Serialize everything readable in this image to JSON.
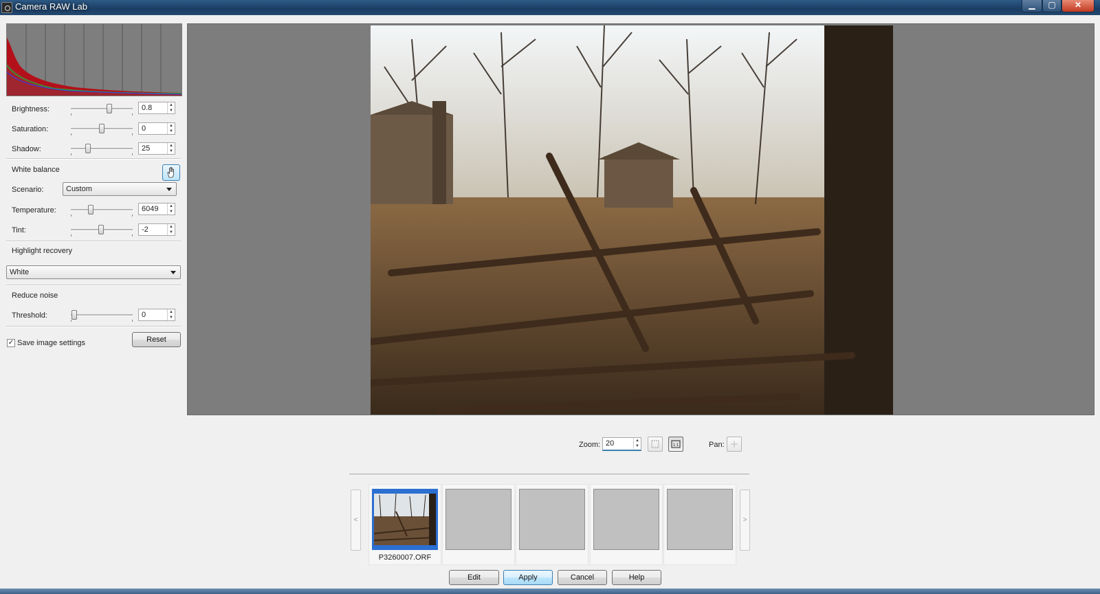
{
  "window": {
    "title": "Camera RAW Lab",
    "minimize": "▁",
    "maximize": "▢",
    "close": "✕"
  },
  "adjust": {
    "brightness": {
      "label": "Brightness:",
      "value": "0.8",
      "level": 0.62
    },
    "saturation": {
      "label": "Saturation:",
      "value": "0",
      "level": 0.5
    },
    "shadow": {
      "label": "Shadow:",
      "value": "25",
      "level": 0.28
    },
    "white_balance": {
      "label": "White balance",
      "button_icon": "hand-picker-icon"
    },
    "scenario": {
      "label": "Scenario:",
      "value": "Custom"
    },
    "temperature": {
      "label": "Temperature:",
      "value": "6049",
      "level": 0.32
    },
    "tint": {
      "label": "Tint:",
      "value": "-2",
      "level": 0.49
    },
    "highlight_recovery": {
      "label": "Highlight recovery",
      "value": "White"
    },
    "reduce_noise": {
      "label": "Reduce noise"
    },
    "threshold": {
      "label": "Threshold:",
      "value": "0",
      "level": 0.05
    },
    "save_settings": {
      "label": "Save image settings",
      "checked": true
    },
    "reset_label": "Reset"
  },
  "view": {
    "zoom_label": "Zoom:",
    "zoom_value": "20",
    "pan_label": "Pan:"
  },
  "filmstrip": {
    "prev": "<",
    "next": ">",
    "items": [
      {
        "name": "P3260007.ORF",
        "selected": true
      },
      {
        "name": ""
      },
      {
        "name": ""
      },
      {
        "name": ""
      },
      {
        "name": ""
      }
    ]
  },
  "actions": {
    "edit": "Edit",
    "apply": "Apply",
    "cancel": "Cancel",
    "help": "Help"
  },
  "colors": {
    "titlebar": "#1b3d63",
    "accent": "#3c7fb1",
    "preview_bg": "#7d7d7d"
  }
}
